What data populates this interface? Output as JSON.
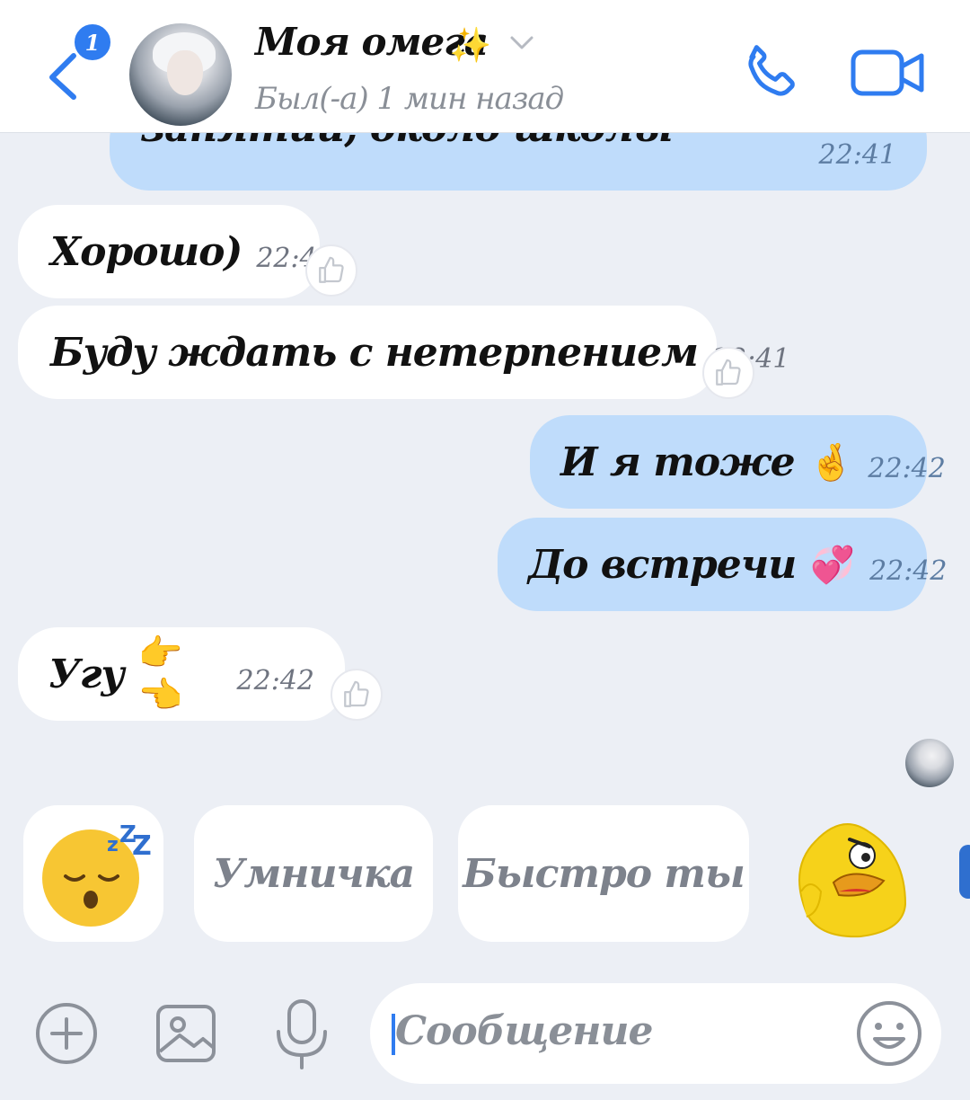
{
  "header": {
    "unread_count": "1",
    "contact_name": "Моя омега",
    "contact_name_emoji": "✨",
    "status": "Был(-а) 1 мин назад"
  },
  "messages": [
    {
      "direction": "out",
      "text": "занятий, около школы",
      "time": "22:41"
    },
    {
      "direction": "in",
      "text": "Хорошо)",
      "time": "22:41"
    },
    {
      "direction": "in",
      "text": "Буду ждать с нетерпением",
      "time": "22:41"
    },
    {
      "direction": "out",
      "text": "И я тоже",
      "emoji": "🤞",
      "time": "22:42"
    },
    {
      "direction": "out",
      "text": "До встречи",
      "emoji": "💞",
      "time": "22:42"
    },
    {
      "direction": "in",
      "text": "Угу",
      "emoji": "👉👈",
      "time": "22:42"
    }
  ],
  "suggestions": {
    "emoji": "😴",
    "chips": [
      "Умничка",
      "Быстро ты"
    ],
    "sticker": "duck-sticker"
  },
  "input": {
    "placeholder": "Сообщение"
  },
  "colors": {
    "accent": "#2f7cf0",
    "outgoing_bubble": "#bfdcfb",
    "incoming_bubble": "#ffffff",
    "background": "#eceff5"
  }
}
